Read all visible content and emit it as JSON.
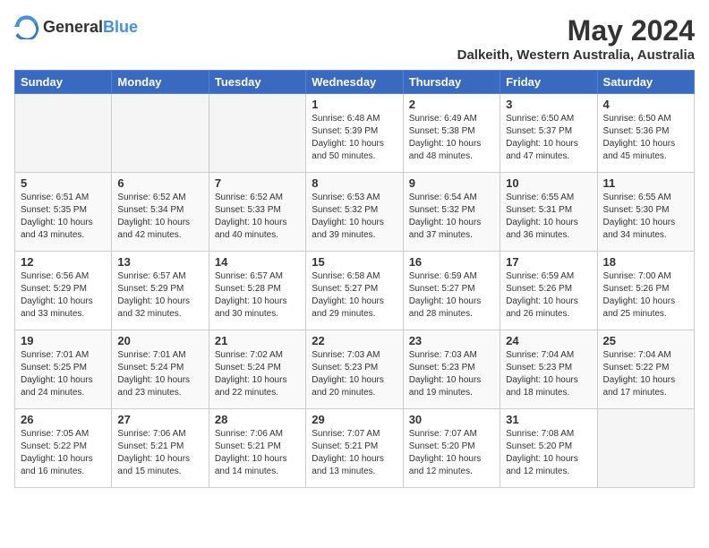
{
  "header": {
    "logo_general": "General",
    "logo_blue": "Blue",
    "month_year": "May 2024",
    "location": "Dalkeith, Western Australia, Australia"
  },
  "days_of_week": [
    "Sunday",
    "Monday",
    "Tuesday",
    "Wednesday",
    "Thursday",
    "Friday",
    "Saturday"
  ],
  "weeks": [
    [
      {
        "day": "",
        "empty": true
      },
      {
        "day": "",
        "empty": true
      },
      {
        "day": "",
        "empty": true
      },
      {
        "day": "1",
        "sunrise": "6:48 AM",
        "sunset": "5:39 PM",
        "daylight": "10 hours and 50 minutes."
      },
      {
        "day": "2",
        "sunrise": "6:49 AM",
        "sunset": "5:38 PM",
        "daylight": "10 hours and 48 minutes."
      },
      {
        "day": "3",
        "sunrise": "6:50 AM",
        "sunset": "5:37 PM",
        "daylight": "10 hours and 47 minutes."
      },
      {
        "day": "4",
        "sunrise": "6:50 AM",
        "sunset": "5:36 PM",
        "daylight": "10 hours and 45 minutes."
      }
    ],
    [
      {
        "day": "5",
        "sunrise": "6:51 AM",
        "sunset": "5:35 PM",
        "daylight": "10 hours and 43 minutes."
      },
      {
        "day": "6",
        "sunrise": "6:52 AM",
        "sunset": "5:34 PM",
        "daylight": "10 hours and 42 minutes."
      },
      {
        "day": "7",
        "sunrise": "6:52 AM",
        "sunset": "5:33 PM",
        "daylight": "10 hours and 40 minutes."
      },
      {
        "day": "8",
        "sunrise": "6:53 AM",
        "sunset": "5:32 PM",
        "daylight": "10 hours and 39 minutes."
      },
      {
        "day": "9",
        "sunrise": "6:54 AM",
        "sunset": "5:32 PM",
        "daylight": "10 hours and 37 minutes."
      },
      {
        "day": "10",
        "sunrise": "6:55 AM",
        "sunset": "5:31 PM",
        "daylight": "10 hours and 36 minutes."
      },
      {
        "day": "11",
        "sunrise": "6:55 AM",
        "sunset": "5:30 PM",
        "daylight": "10 hours and 34 minutes."
      }
    ],
    [
      {
        "day": "12",
        "sunrise": "6:56 AM",
        "sunset": "5:29 PM",
        "daylight": "10 hours and 33 minutes."
      },
      {
        "day": "13",
        "sunrise": "6:57 AM",
        "sunset": "5:29 PM",
        "daylight": "10 hours and 32 minutes."
      },
      {
        "day": "14",
        "sunrise": "6:57 AM",
        "sunset": "5:28 PM",
        "daylight": "10 hours and 30 minutes."
      },
      {
        "day": "15",
        "sunrise": "6:58 AM",
        "sunset": "5:27 PM",
        "daylight": "10 hours and 29 minutes."
      },
      {
        "day": "16",
        "sunrise": "6:59 AM",
        "sunset": "5:27 PM",
        "daylight": "10 hours and 28 minutes."
      },
      {
        "day": "17",
        "sunrise": "6:59 AM",
        "sunset": "5:26 PM",
        "daylight": "10 hours and 26 minutes."
      },
      {
        "day": "18",
        "sunrise": "7:00 AM",
        "sunset": "5:26 PM",
        "daylight": "10 hours and 25 minutes."
      }
    ],
    [
      {
        "day": "19",
        "sunrise": "7:01 AM",
        "sunset": "5:25 PM",
        "daylight": "10 hours and 24 minutes."
      },
      {
        "day": "20",
        "sunrise": "7:01 AM",
        "sunset": "5:24 PM",
        "daylight": "10 hours and 23 minutes."
      },
      {
        "day": "21",
        "sunrise": "7:02 AM",
        "sunset": "5:24 PM",
        "daylight": "10 hours and 22 minutes."
      },
      {
        "day": "22",
        "sunrise": "7:03 AM",
        "sunset": "5:23 PM",
        "daylight": "10 hours and 20 minutes."
      },
      {
        "day": "23",
        "sunrise": "7:03 AM",
        "sunset": "5:23 PM",
        "daylight": "10 hours and 19 minutes."
      },
      {
        "day": "24",
        "sunrise": "7:04 AM",
        "sunset": "5:23 PM",
        "daylight": "10 hours and 18 minutes."
      },
      {
        "day": "25",
        "sunrise": "7:04 AM",
        "sunset": "5:22 PM",
        "daylight": "10 hours and 17 minutes."
      }
    ],
    [
      {
        "day": "26",
        "sunrise": "7:05 AM",
        "sunset": "5:22 PM",
        "daylight": "10 hours and 16 minutes."
      },
      {
        "day": "27",
        "sunrise": "7:06 AM",
        "sunset": "5:21 PM",
        "daylight": "10 hours and 15 minutes."
      },
      {
        "day": "28",
        "sunrise": "7:06 AM",
        "sunset": "5:21 PM",
        "daylight": "10 hours and 14 minutes."
      },
      {
        "day": "29",
        "sunrise": "7:07 AM",
        "sunset": "5:21 PM",
        "daylight": "10 hours and 13 minutes."
      },
      {
        "day": "30",
        "sunrise": "7:07 AM",
        "sunset": "5:20 PM",
        "daylight": "10 hours and 12 minutes."
      },
      {
        "day": "31",
        "sunrise": "7:08 AM",
        "sunset": "5:20 PM",
        "daylight": "10 hours and 12 minutes."
      },
      {
        "day": "",
        "empty": true
      }
    ]
  ],
  "labels": {
    "sunrise_prefix": "Sunrise: ",
    "sunset_prefix": "Sunset: ",
    "daylight_prefix": "Daylight: "
  }
}
